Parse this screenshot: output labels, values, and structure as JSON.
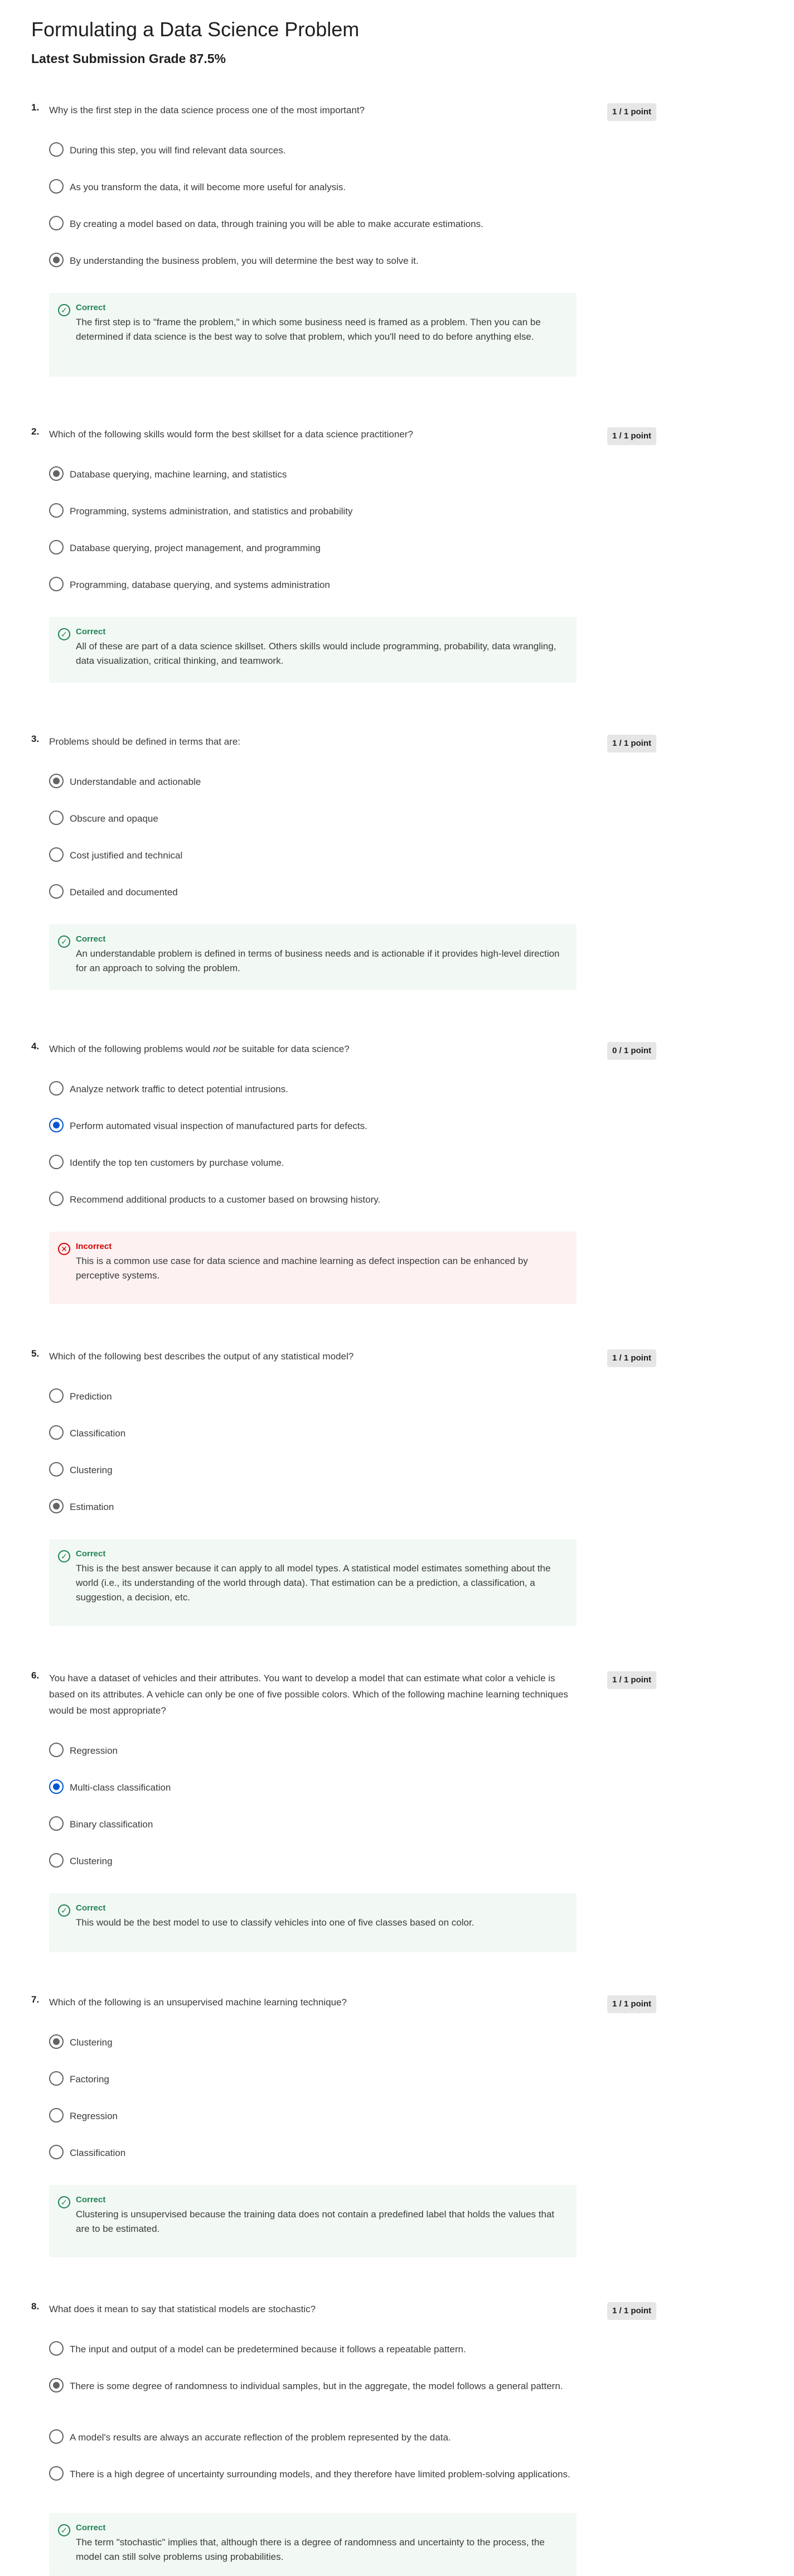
{
  "header": {
    "title": "Formulating a Data Science Problem",
    "grade": "Latest Submission Grade 87.5%"
  },
  "questions": [
    {
      "number": "1.",
      "text": "Why is the first step in the data science process one of the most important?",
      "points": "1 / 1 point",
      "options": [
        "During this step, you will find relevant data sources.",
        "As you transform the data, it will become more useful for analysis.",
        "By creating a model based on data, through training you will be able to make accurate estimations.",
        "By understanding the business problem, you will determine the best way to solve it."
      ],
      "selected_index": 3,
      "feedback_status": "Correct",
      "feedback_text": "The first step is to \"frame the problem,\" in which some business need is framed as a problem. Then you can be determined if data science is the best way to solve that problem, which you'll need to do before anything else."
    },
    {
      "number": "2.",
      "text": "Which of the following skills would form the best skillset for a data science practitioner?",
      "points": "1 / 1 point",
      "options": [
        "Database querying, machine learning, and statistics",
        "Programming, systems administration, and statistics and probability",
        "Database querying, project management, and programming",
        "Programming, database querying, and systems administration"
      ],
      "selected_index": 0,
      "feedback_status": "Correct",
      "feedback_text": "All of these are part of a data science skillset. Others skills would include programming, probability, data wrangling, data visualization, critical thinking, and teamwork."
    },
    {
      "number": "3.",
      "text": "Problems should be defined in terms that are:",
      "points": "1 / 1 point",
      "options": [
        "Understandable and actionable",
        "Obscure and opaque",
        "Cost justified and technical",
        "Detailed and documented"
      ],
      "selected_index": 0,
      "feedback_status": "Correct",
      "feedback_text": "An understandable problem is defined in terms of business needs and is actionable if it provides high-level direction for an approach to solving the problem."
    },
    {
      "number": "4.",
      "text_before": "Which of the following problems would ",
      "text_emphasis": "not",
      "text_after": " be suitable for data science?",
      "points": "0 / 1 point",
      "options": [
        "Analyze network traffic to detect potential intrusions.",
        "Perform automated visual inspection of manufactured parts for defects.",
        "Identify the top ten customers by purchase volume.",
        "Recommend additional products to a customer based on browsing history."
      ],
      "selected_index": 1,
      "feedback_status": "Incorrect",
      "feedback_text": "This is a common use case for data science and machine learning as defect inspection can be enhanced by perceptive systems."
    },
    {
      "number": "5.",
      "text": "Which of the following best describes the output of any statistical model?",
      "points": "1 / 1 point",
      "options": [
        "Prediction",
        "Classification",
        "Clustering",
        "Estimation"
      ],
      "selected_index": 3,
      "feedback_status": "Correct",
      "feedback_text": "This is the best answer because it can apply to all model types. A statistical model estimates something about the world (i.e., its understanding of the world through data). That estimation can be a prediction, a classification, a suggestion, a decision, etc."
    },
    {
      "number": "6.",
      "text": "You have a dataset of vehicles and their attributes. You want to develop a model that can estimate what color a vehicle is based on its attributes. A vehicle can only be one of five possible colors. Which of the following machine learning techniques would be most appropriate?",
      "points": "1 / 1 point",
      "options": [
        "Regression",
        "Multi-class classification",
        "Binary classification",
        "Clustering"
      ],
      "selected_index": 1,
      "feedback_status": "Correct",
      "feedback_text": "This would be the best model to use to classify vehicles into one of five classes based on color."
    },
    {
      "number": "7.",
      "text": "Which of the following is an unsupervised machine learning technique?",
      "points": "1 / 1 point",
      "options": [
        "Clustering",
        "Factoring",
        "Regression",
        "Classification"
      ],
      "selected_index": 0,
      "feedback_status": "Correct",
      "feedback_text": "Clustering is unsupervised because the training data does not contain a predefined label that holds the values that are to be estimated."
    },
    {
      "number": "8.",
      "text": "What does it mean to say that statistical models are stochastic?",
      "points": "1 / 1 point",
      "options": [
        "The input and output of a model can be predetermined because it follows a repeatable pattern.",
        "There is some degree of randomness to individual samples, but in the aggregate, the model follows a general pattern.",
        "A model's results are always an accurate reflection of the problem represented by the data.",
        "There is a high degree of uncertainty surrounding models, and they therefore have limited problem-solving applications."
      ],
      "selected_index": 1,
      "feedback_status": "Correct",
      "feedback_text": "The term \"stochastic\" implies that, although there is a degree of randomness and uncertainty to the process, the model can still solve problems using probabilities."
    }
  ]
}
